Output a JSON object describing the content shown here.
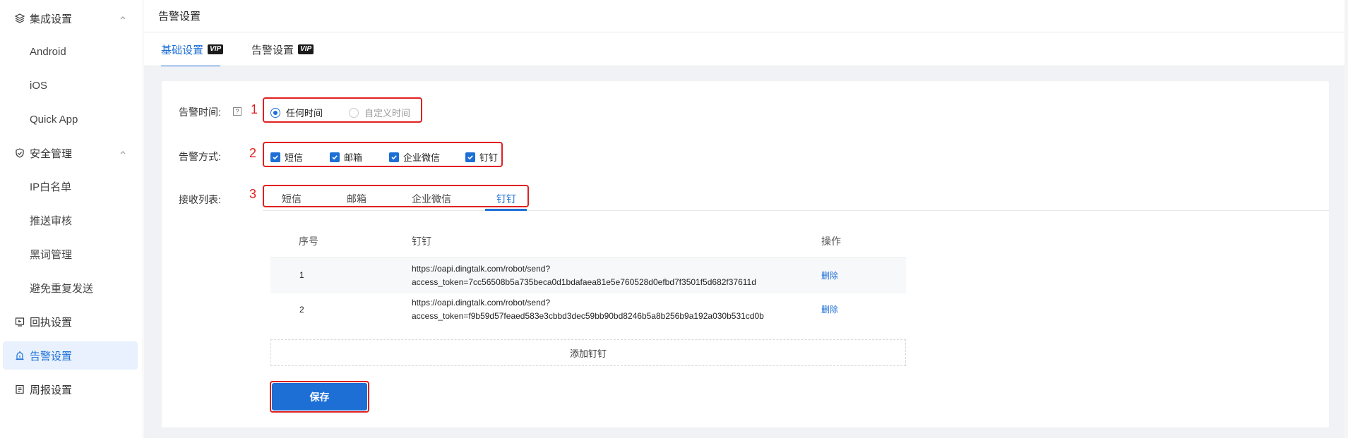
{
  "sidebar": {
    "items": [
      {
        "label": "集成设置",
        "type": "group",
        "icon": "layers-icon",
        "expanded": true
      },
      {
        "label": "Android",
        "type": "sub"
      },
      {
        "label": "iOS",
        "type": "sub"
      },
      {
        "label": "Quick App",
        "type": "sub"
      },
      {
        "label": "安全管理",
        "type": "group",
        "icon": "shield-icon",
        "expanded": true
      },
      {
        "label": "IP白名单",
        "type": "sub"
      },
      {
        "label": "推送审核",
        "type": "sub"
      },
      {
        "label": "黑词管理",
        "type": "sub"
      },
      {
        "label": "避免重复发送",
        "type": "sub"
      },
      {
        "label": "回执设置",
        "type": "group",
        "icon": "receipt-icon"
      },
      {
        "label": "告警设置",
        "type": "group",
        "icon": "alarm-icon",
        "active": true
      },
      {
        "label": "周报设置",
        "type": "group",
        "icon": "report-icon"
      }
    ]
  },
  "header": {
    "title": "告警设置"
  },
  "tabs": [
    {
      "label": "基础设置",
      "badge": "VIP",
      "active": true
    },
    {
      "label": "告警设置",
      "badge": "VIP",
      "active": false
    }
  ],
  "form": {
    "time_label": "告警时间:",
    "time_help": "?",
    "time_options": [
      {
        "label": "任何时间",
        "checked": true
      },
      {
        "label": "自定义时间",
        "checked": false
      }
    ],
    "method_label": "告警方式:",
    "methods": [
      {
        "label": "短信",
        "checked": true
      },
      {
        "label": "邮箱",
        "checked": true
      },
      {
        "label": "企业微信",
        "checked": true
      },
      {
        "label": "钉钉",
        "checked": true
      }
    ],
    "receive_label": "接收列表:",
    "receive_tabs": [
      {
        "label": "短信"
      },
      {
        "label": "邮箱"
      },
      {
        "label": "企业微信"
      },
      {
        "label": "钉钉",
        "active": true
      }
    ],
    "annotations": [
      "1",
      "2",
      "3"
    ]
  },
  "table": {
    "headers": [
      "序号",
      "钉钉",
      "操作"
    ],
    "rows": [
      {
        "index": "1",
        "line1": "https://oapi.dingtalk.com/robot/send?",
        "line2": "access_token=7cc56508b5a735beca0d1bdafaea81e5e760528d0efbd7f3501f5d682f37611d",
        "action": "删除"
      },
      {
        "index": "2",
        "line1": "https://oapi.dingtalk.com/robot/send?",
        "line2": "access_token=f9b59d57feaed583e3cbbd3dec59bb90bd8246b5a8b256b9a192a030b531cd0b",
        "action": "删除"
      }
    ],
    "add_label": "添加钉钉"
  },
  "save_label": "保存",
  "colors": {
    "accent": "#1d6fd6",
    "annotation": "#e02020",
    "content_bg": "#f0f2f5"
  }
}
